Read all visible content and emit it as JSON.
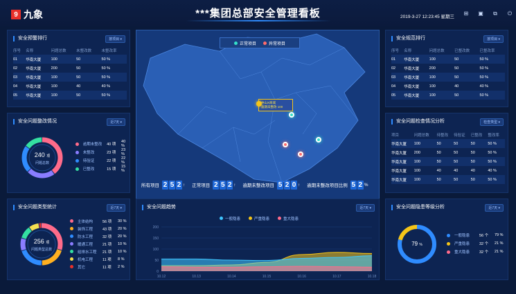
{
  "header": {
    "logo_mark": "9",
    "logo_text": "九象",
    "title": "***集团总部安全管理看板",
    "datetime": "2019-3-27  12:23:45  星期三"
  },
  "warning_rank": {
    "title": "安全预警排行",
    "filter": "按项目 ▾",
    "columns": [
      "序号",
      "名称",
      "问题总数",
      "未整改数",
      "未整改率"
    ],
    "rows": [
      [
        "01",
        "华南大厦",
        "100",
        "50",
        "50 %"
      ],
      [
        "02",
        "华南大厦",
        "200",
        "50",
        "50 %"
      ],
      [
        "03",
        "华南大厦",
        "100",
        "50",
        "50 %"
      ],
      [
        "04",
        "华南大厦",
        "100",
        "40",
        "40 %"
      ],
      [
        "05",
        "华南大厦",
        "100",
        "50",
        "50 %"
      ]
    ]
  },
  "rectify": {
    "title": "安全问题整改情况",
    "filter": "近7天 ▾",
    "total": "240",
    "unit": "项",
    "total_label": "问题总数",
    "items": [
      {
        "label": "逾期未整改",
        "count": "40 项",
        "pct": "40 %",
        "value": 40,
        "color": "#ff6b8a"
      },
      {
        "label": "未整改",
        "count": "23 项",
        "pct": "23 %",
        "value": 23,
        "color": "#8a7dff"
      },
      {
        "label": "待验证",
        "count": "22 项",
        "pct": "22 %",
        "value": 22,
        "color": "#2f8cff"
      },
      {
        "label": "已整改",
        "count": "15 项",
        "pct": "15 %",
        "value": 15,
        "color": "#34e0a1"
      }
    ]
  },
  "types": {
    "title": "安全问题类型统计",
    "filter": "近7天 ▾",
    "total": "256",
    "unit": "项",
    "total_label": "问题类型总数",
    "items": [
      {
        "label": "主体结构",
        "count": "56 项",
        "pct": "30 %",
        "value": 30,
        "color": "#ff6b8a"
      },
      {
        "label": "装饰工程",
        "count": "43 项",
        "pct": "20 %",
        "value": 20,
        "color": "#ffb020"
      },
      {
        "label": "防水工程",
        "count": "32 项",
        "pct": "20 %",
        "value": 20,
        "color": "#2f8cff"
      },
      {
        "label": "暖通工程",
        "count": "21 项",
        "pct": "10 %",
        "value": 10,
        "color": "#8a7dff"
      },
      {
        "label": "给排水工程",
        "count": "21 项",
        "pct": "10 %",
        "value": 10,
        "color": "#34e0a1"
      },
      {
        "label": "机电工程",
        "count": "11 项",
        "pct": "8 %",
        "value": 8,
        "color": "#f5e050"
      },
      {
        "label": "其它",
        "count": "11 项",
        "pct": "2 %",
        "value": 2,
        "color": "#e8302a"
      }
    ]
  },
  "map": {
    "legend_normal": "正常项目",
    "legend_abnormal": "异常项目",
    "tooltip_name": "中山X商城",
    "tooltip_status": "逾期未整改",
    "tooltip_value": "100",
    "markers": [
      {
        "kind": "normal",
        "lon": 112.5,
        "lat": 36.4
      },
      {
        "kind": "normal",
        "lon": 119.3,
        "lat": 31.3
      },
      {
        "kind": "abnormal",
        "lon": 110.9,
        "lat": 30.3
      },
      {
        "kind": "abnormal",
        "lon": 114.7,
        "lat": 28.2
      }
    ]
  },
  "stats": {
    "all_label": "所有项目",
    "all_value": "252",
    "normal_label": "正常项目",
    "normal_value": "252",
    "overdue_label": "逾期未整改项目",
    "overdue_value": "520",
    "ratio_label": "逾期未整改项目比例",
    "ratio_value": "52",
    "ratio_unit": "%",
    "arrow": "↑"
  },
  "trend": {
    "title": "安全问题趋势",
    "filter": "近7天 ▾",
    "legend": [
      {
        "label": "一般隐患",
        "color": "#3fc6ff"
      },
      {
        "label": "严重隐患",
        "color": "#f5c518"
      },
      {
        "label": "重大隐患",
        "color": "#ff6b8a"
      }
    ]
  },
  "chart_data": {
    "type": "area",
    "categories": [
      "10.12",
      "10.13",
      "10.14",
      "10.15",
      "10.16",
      "10.17",
      "10.18"
    ],
    "ylim": [
      0,
      200
    ],
    "yticks": [
      "0",
      "50",
      "100",
      "150",
      "200"
    ],
    "series": [
      {
        "name": "一般隐患",
        "values": [
          55,
          55,
          50,
          48,
          58,
          62,
          70
        ]
      },
      {
        "name": "严重隐患",
        "values": [
          25,
          25,
          28,
          40,
          75,
          85,
          80
        ]
      },
      {
        "name": "重大隐患",
        "values": [
          20,
          18,
          18,
          20,
          22,
          20,
          18
        ]
      }
    ]
  },
  "standard_rank": {
    "title": "安全规范排行",
    "filter": "按项目 ▾",
    "columns": [
      "序号",
      "名称",
      "问题总数",
      "已整改数",
      "已整改率"
    ],
    "rows": [
      [
        "01",
        "华南大厦",
        "100",
        "50",
        "50 %"
      ],
      [
        "02",
        "华南大厦",
        "200",
        "50",
        "50 %"
      ],
      [
        "03",
        "华南大厦",
        "100",
        "50",
        "50 %"
      ],
      [
        "04",
        "华南大厦",
        "100",
        "40",
        "40 %"
      ],
      [
        "05",
        "华南大厦",
        "100",
        "50",
        "50 %"
      ]
    ]
  },
  "inspection": {
    "title": "安全问题检查情况分析",
    "filter": "检查类型 ▾",
    "columns": [
      "项目",
      "问题总数",
      "待整改",
      "待验证",
      "已整改",
      "整改率"
    ],
    "rows": [
      [
        "华南大厦",
        "100",
        "50",
        "50",
        "50",
        "50 %"
      ],
      [
        "华南大厦",
        "200",
        "50",
        "50",
        "50",
        "50 %"
      ],
      [
        "华南大厦",
        "100",
        "50",
        "50",
        "50",
        "50 %"
      ],
      [
        "华南大厦",
        "100",
        "40",
        "40",
        "40",
        "40 %"
      ],
      [
        "华南大厦",
        "100",
        "50",
        "50",
        "50",
        "50 %"
      ]
    ]
  },
  "levels": {
    "title": "安全问题隐患等级分析",
    "filter": "近7天 ▾",
    "center": "79",
    "center_unit": "%",
    "items": [
      {
        "label": "一般隐患",
        "count": "56 个",
        "pct": "79 %",
        "value": 79,
        "color": "#2f8cff"
      },
      {
        "label": "严重隐患",
        "count": "32 个",
        "pct": "21 %",
        "value": 21,
        "color": "#f5c518"
      },
      {
        "label": "重大隐患",
        "count": "32 个",
        "pct": "21 %",
        "value": 21,
        "color": "#ff6b8a"
      }
    ]
  }
}
